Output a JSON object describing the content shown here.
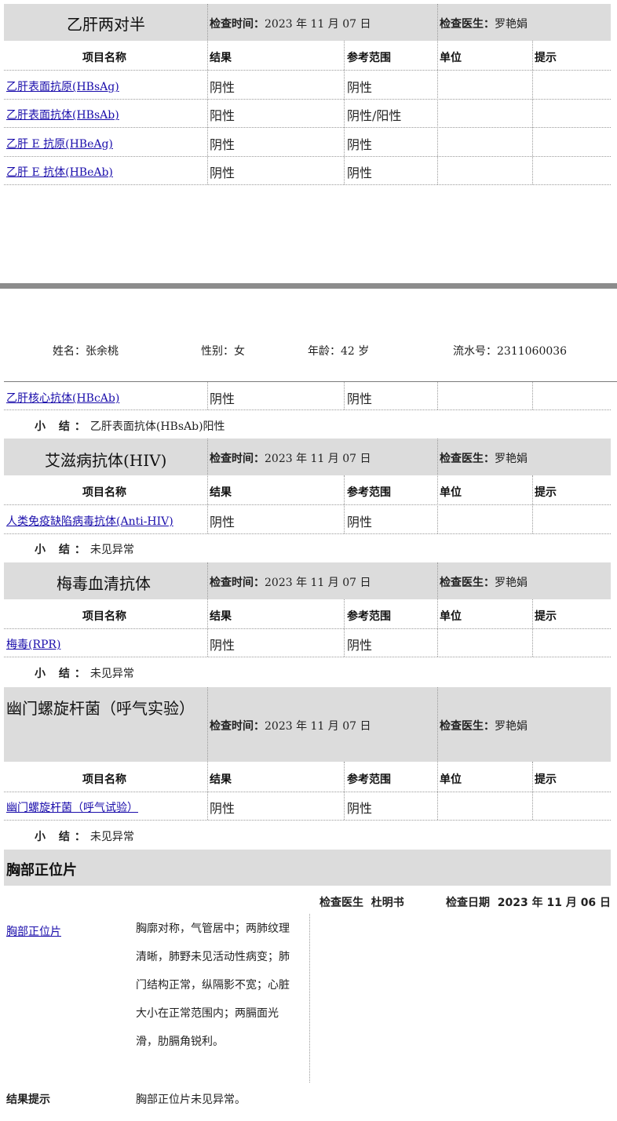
{
  "columns": {
    "item": "项目名称",
    "result": "结果",
    "range": "参考范围",
    "unit": "单位",
    "hint": "提示"
  },
  "meta_labels": {
    "time": "检查时间：",
    "doctor": "检查医生："
  },
  "summary_label": "小 结：",
  "hbv": {
    "title": "乙肝两对半",
    "time": "2023 年 11 月 07 日",
    "doctor": "罗艳娟",
    "rows": [
      {
        "item": "乙肝表面抗原(HBsAg)",
        "result": "阴性",
        "range": "阴性"
      },
      {
        "item": "乙肝表面抗体(HBsAb)",
        "result": "阳性",
        "range": "阴性/阳性"
      },
      {
        "item": "乙肝 E 抗原(HBeAg)",
        "result": "阴性",
        "range": "阴性"
      },
      {
        "item": "乙肝 E 抗体(HBeAb)",
        "result": "阴性",
        "range": "阴性"
      }
    ],
    "cont_row": {
      "item": "乙肝核心抗体(HBcAb)",
      "result": "阴性",
      "range": "阴性"
    },
    "summary": "乙肝表面抗体(HBsAb)阳性"
  },
  "patient": {
    "name": "姓名：张余桃",
    "gender": "性别：女",
    "age": "年龄：42 岁",
    "serial": "流水号：2311060036"
  },
  "hiv": {
    "title": "艾滋病抗体(HIV)",
    "time": "2023 年 11 月 07 日",
    "doctor": "罗艳娟",
    "rows": [
      {
        "item": "人类免疫缺陷病毒抗体(Anti-HIV)",
        "result": "阴性",
        "range": "阴性"
      }
    ],
    "summary": "未见异常"
  },
  "syphilis": {
    "title": "梅毒血清抗体",
    "time": "2023 年 11 月 07 日",
    "doctor": "罗艳娟",
    "rows": [
      {
        "item": "梅毒(RPR)",
        "result": "阴性",
        "range": "阴性"
      }
    ],
    "summary": "未见异常"
  },
  "hp": {
    "title": "幽门螺旋杆菌（呼气实验）",
    "time": "2023 年 11 月 07 日",
    "doctor": "罗艳娟",
    "rows": [
      {
        "item": "幽门螺旋杆菌（呼气试验）",
        "result": "阴性",
        "range": "阴性"
      }
    ],
    "summary": "未见异常"
  },
  "xray": {
    "title": "胸部正位片",
    "doctor_label": "检查医生",
    "doctor": "杜明书",
    "date_label": "检查日期",
    "date": "2023 年 11 月 06 日",
    "item": "胸部正位片",
    "finding": "胸廓对称，气管居中；两肺纹理清晰，肺野未见活动性病变；肺门结构正常，纵隔影不宽；心脏大小在正常范围内；两膈面光滑，肋膈角锐利。",
    "result_label": "结果提示",
    "result": "胸部正位片未见异常。"
  }
}
